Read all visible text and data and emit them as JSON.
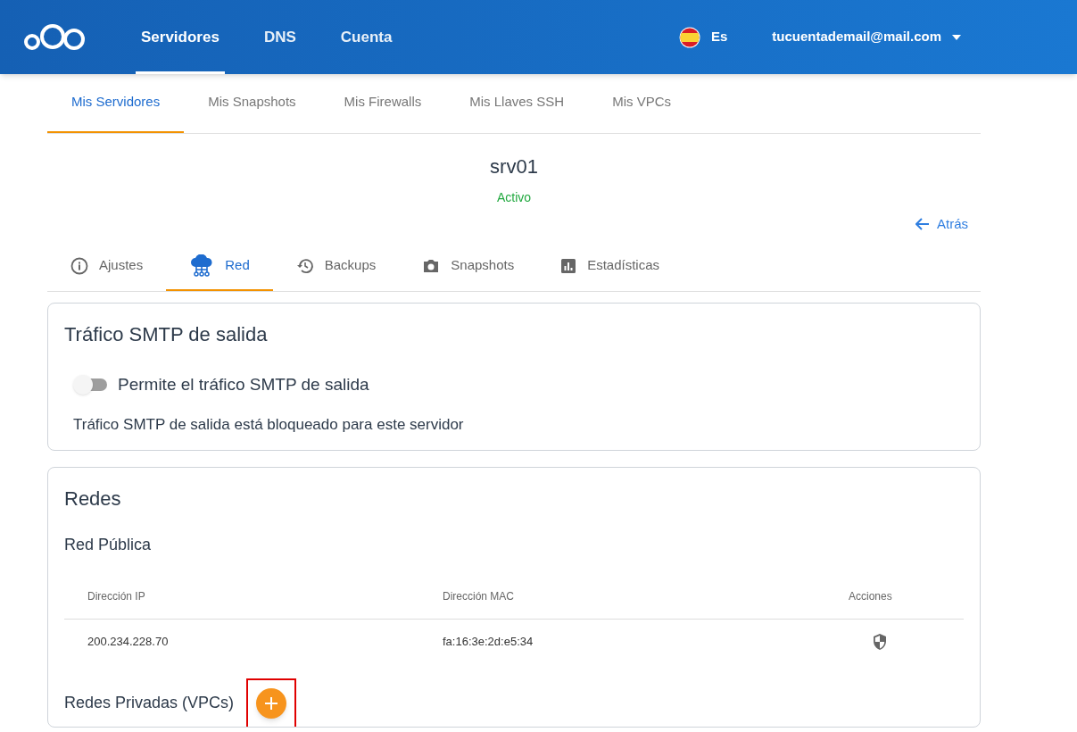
{
  "top_nav": {
    "items": [
      {
        "label": "Servidores",
        "selected": true
      },
      {
        "label": "DNS",
        "selected": false
      },
      {
        "label": "Cuenta",
        "selected": false
      }
    ],
    "language": "Es",
    "account": "tucuentademail@mail.com"
  },
  "sub_nav": [
    {
      "label": "Mis Servidores",
      "selected": true
    },
    {
      "label": "Mis Snapshots",
      "selected": false
    },
    {
      "label": "Mis Firewalls",
      "selected": false
    },
    {
      "label": "Mis Llaves SSH",
      "selected": false
    },
    {
      "label": "Mis VPCs",
      "selected": false
    }
  ],
  "server": {
    "name": "srv01",
    "status": "Activo"
  },
  "back_link": "Atrás",
  "server_tabs": [
    {
      "label": "Ajustes",
      "kind": "info",
      "selected": false
    },
    {
      "label": "Red",
      "kind": "cloud",
      "selected": true
    },
    {
      "label": "Backups",
      "kind": "history",
      "selected": false
    },
    {
      "label": "Snapshots",
      "kind": "camera",
      "selected": false
    },
    {
      "label": "Estadísticas",
      "kind": "chart",
      "selected": false
    }
  ],
  "smtp": {
    "title": "Tráfico SMTP de salida",
    "toggle_label": "Permite el tráfico SMTP de salida",
    "on": false,
    "note": "Tráfico SMTP de salida está bloqueado para este servidor"
  },
  "networks": {
    "title": "Redes",
    "public_title": "Red Pública",
    "columns": [
      "Dirección IP",
      "Dirección MAC",
      "Acciones"
    ],
    "rows": [
      {
        "ip": "200.234.228.70",
        "mac": "fa:16:3e:2d:e5:34"
      }
    ],
    "private_title": "Redes Privadas (VPCs)",
    "add_button": {
      "highlighted": true
    }
  }
}
